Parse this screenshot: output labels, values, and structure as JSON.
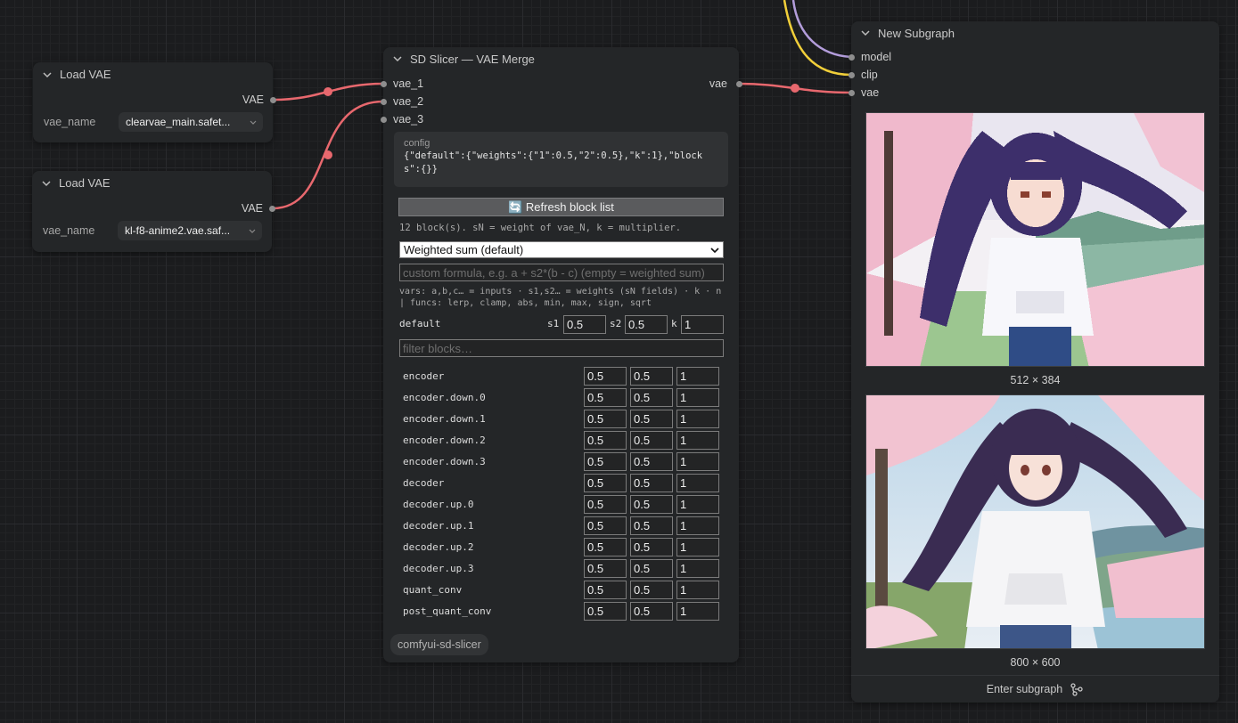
{
  "load_vae_1": {
    "title": "Load VAE",
    "output_label": "VAE",
    "widget_label": "vae_name",
    "widget_value": "clearvae_main.safet..."
  },
  "load_vae_2": {
    "title": "Load VAE",
    "output_label": "VAE",
    "widget_label": "vae_name",
    "widget_value": "kl-f8-anime2.vae.saf..."
  },
  "slicer": {
    "title": "SD Slicer — VAE Merge",
    "inputs": [
      "vae_1",
      "vae_2",
      "vae_3"
    ],
    "output": "vae",
    "config_label": "config",
    "config_value": "{\"default\":{\"weights\":{\"1\":0.5,\"2\":0.5},\"k\":1},\"blocks\":{}}",
    "refresh_icon": "refresh-icon",
    "refresh_label": "🔄 Refresh block list",
    "block_info": "12 block(s). sN = weight of vae_N, k = multiplier.",
    "mode_select": "Weighted sum (default)",
    "formula_placeholder": "custom formula, e.g.  a + s2*(b - c)   (empty = weighted sum)",
    "vars_line1": "vars: a,b,c… = inputs · s1,s2… = weights (sN fields) · k · n",
    "vars_line2": "| funcs: lerp, clamp, abs, min, max, sign, sqrt",
    "default_label": "default",
    "s1_label": "s1",
    "s1_value": "0.5",
    "s2_label": "s2",
    "s2_value": "0.5",
    "k_label": "k",
    "k_value": "1",
    "filter_placeholder": "filter blocks…",
    "blocks": [
      {
        "name": "encoder",
        "s1": "0.5",
        "s2": "0.5",
        "k": "1"
      },
      {
        "name": "encoder.down.0",
        "s1": "0.5",
        "s2": "0.5",
        "k": "1"
      },
      {
        "name": "encoder.down.1",
        "s1": "0.5",
        "s2": "0.5",
        "k": "1"
      },
      {
        "name": "encoder.down.2",
        "s1": "0.5",
        "s2": "0.5",
        "k": "1"
      },
      {
        "name": "encoder.down.3",
        "s1": "0.5",
        "s2": "0.5",
        "k": "1"
      },
      {
        "name": "decoder",
        "s1": "0.5",
        "s2": "0.5",
        "k": "1"
      },
      {
        "name": "decoder.up.0",
        "s1": "0.5",
        "s2": "0.5",
        "k": "1"
      },
      {
        "name": "decoder.up.1",
        "s1": "0.5",
        "s2": "0.5",
        "k": "1"
      },
      {
        "name": "decoder.up.2",
        "s1": "0.5",
        "s2": "0.5",
        "k": "1"
      },
      {
        "name": "decoder.up.3",
        "s1": "0.5",
        "s2": "0.5",
        "k": "1"
      },
      {
        "name": "quant_conv",
        "s1": "0.5",
        "s2": "0.5",
        "k": "1"
      },
      {
        "name": "post_quant_conv",
        "s1": "0.5",
        "s2": "0.5",
        "k": "1"
      }
    ],
    "badge": "comfyui-sd-slicer"
  },
  "subgraph": {
    "title": "New Subgraph",
    "inputs": [
      "model",
      "clip",
      "vae"
    ],
    "image1_caption": "512 × 384",
    "image2_caption": "800 × 600",
    "footer_label": "Enter subgraph",
    "footer_icon": "subgraph-icon"
  },
  "colors": {
    "vae_link": "#e8686e",
    "clip_link": "#f1cf3a",
    "model_link": "#b39ddb",
    "node_bg": "#242628",
    "canvas_bg": "#1b1c1e"
  }
}
